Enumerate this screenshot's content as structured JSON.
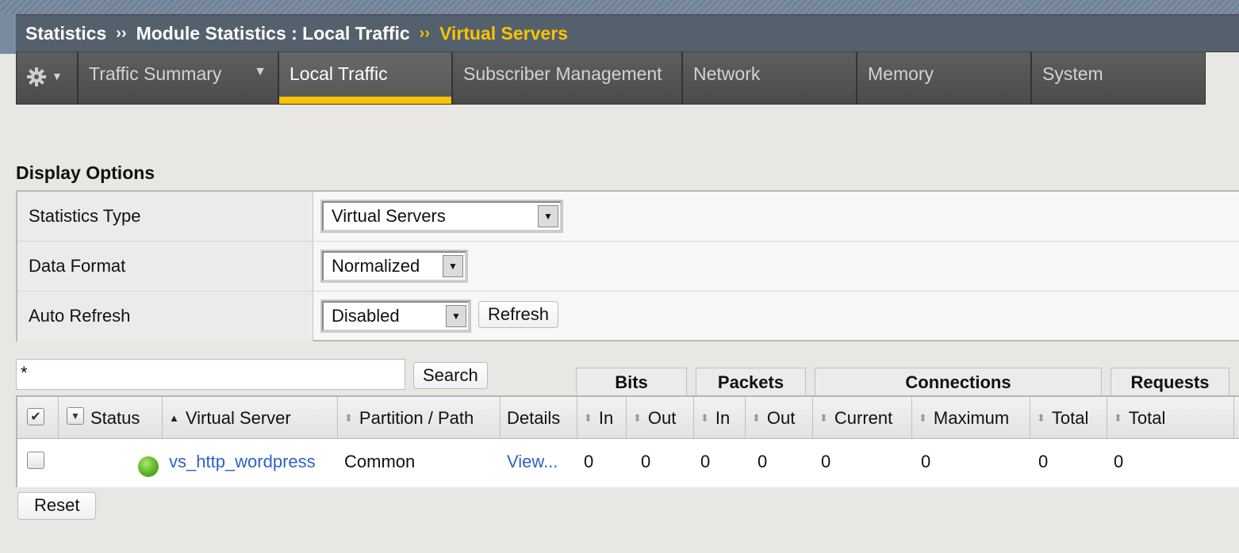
{
  "breadcrumb": {
    "part1": "Statistics",
    "sep1": "››",
    "part2": "Module Statistics : Local Traffic",
    "sep2": "››",
    "current": "Virtual Servers"
  },
  "tabs": [
    {
      "label": "Traffic Summary",
      "has_dropdown": true
    },
    {
      "label": "Local Traffic",
      "active": true
    },
    {
      "label": "Subscriber Management"
    },
    {
      "label": "Network"
    },
    {
      "label": "Memory"
    },
    {
      "label": "System"
    }
  ],
  "display_options": {
    "title": "Display Options",
    "statistics_type_label": "Statistics Type",
    "statistics_type_value": "Virtual Servers",
    "data_format_label": "Data Format",
    "data_format_value": "Normalized",
    "auto_refresh_label": "Auto Refresh",
    "auto_refresh_value": "Disabled",
    "refresh_button": "Refresh"
  },
  "search": {
    "value": "*",
    "button": "Search"
  },
  "groups": {
    "bits": "Bits",
    "packets": "Packets",
    "connections": "Connections",
    "requests": "Requests"
  },
  "columns": {
    "status": "Status",
    "virtual_server": "Virtual Server",
    "partition_path": "Partition / Path",
    "details": "Details",
    "bits_in": "In",
    "bits_out": "Out",
    "packets_in": "In",
    "packets_out": "Out",
    "conn_current": "Current",
    "conn_maximum": "Maximum",
    "conn_total": "Total",
    "req_total": "Total"
  },
  "rows": [
    {
      "status": "available",
      "status_color": "#5bb327",
      "name": "vs_http_wordpress",
      "partition": "Common",
      "details": "View...",
      "bits_in": "0",
      "bits_out": "0",
      "packets_in": "0",
      "packets_out": "0",
      "conn_current": "0",
      "conn_maximum": "0",
      "conn_total": "0",
      "req_total": "0"
    }
  ],
  "reset_button": "Reset",
  "colors": {
    "accent": "#f8c400",
    "header_bg": "#55606d",
    "tab_bg": "#4b4b4b",
    "link": "#2c62c9",
    "page_bg": "#e8e7e3"
  }
}
